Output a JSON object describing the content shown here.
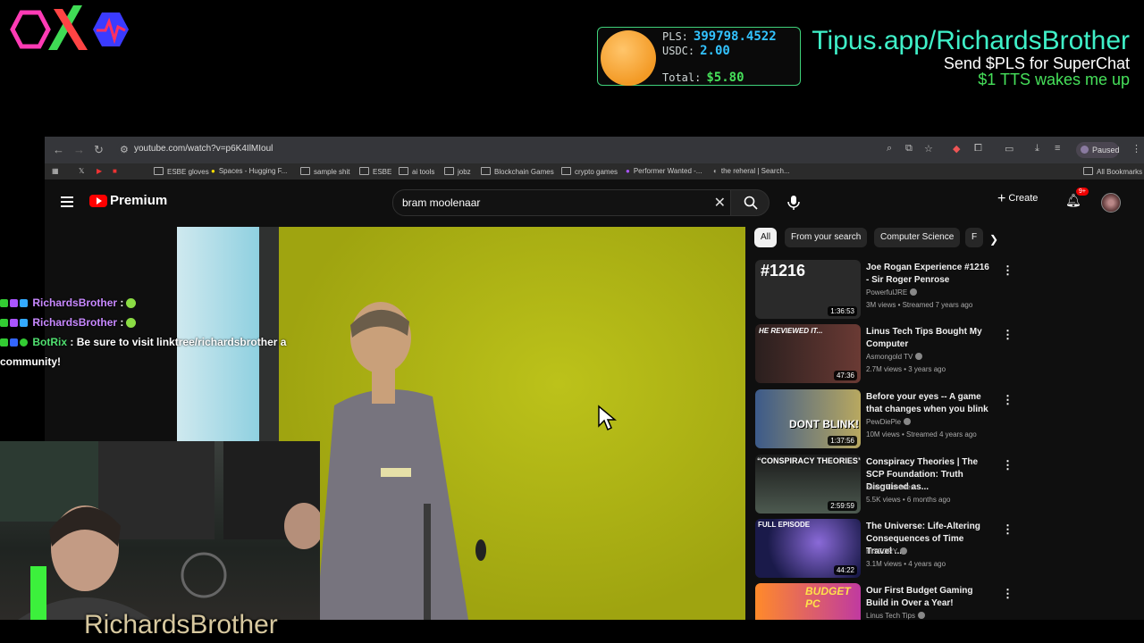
{
  "overlay": {
    "wallet": {
      "pls_label": "PLS:",
      "pls_value": "399798.4522",
      "usdc_label": "USDC:",
      "usdc_value": "2.00",
      "total_label": "Total:",
      "total_value": "$5.80"
    },
    "tip_url": "Tipus.app/RichardsBrother",
    "tip_line1": "Send $PLS for SuperChat",
    "tip_line2": "$1 TTS wakes me up",
    "cam_name": "RichardsBrother"
  },
  "chat": [
    {
      "user": "RichardsBrother",
      "text": ":"
    },
    {
      "user": "RichardsBrother",
      "text": ":"
    },
    {
      "user": "BotRix",
      "text": ": Be sure to visit linktree/richardsbrother a",
      "text2": "community!"
    }
  ],
  "browser": {
    "url": "youtube.com/watch?v=p6K4IlMIoul",
    "paused": "Paused",
    "bookmarks": [
      "ESBE gloves",
      "Spaces - Hugging F...",
      "sample shit",
      "ESBE",
      "ai tools",
      "jobz",
      "Blockchain Games",
      "crypto games",
      "Performer Wanted -...",
      "the reheral | Search..."
    ],
    "all_bookmarks": "All Bookmarks"
  },
  "youtube": {
    "logo": "Premium",
    "search_value": "bram moolenaar",
    "create": "Create",
    "notif_badge": "9+",
    "chips": [
      "All",
      "From your search",
      "Computer Science",
      "F"
    ],
    "recommendations": [
      {
        "title": "Joe Rogan Experience #1216 - Sir Roger Penrose",
        "channel": "PowerfulJRE",
        "meta": "3M views • Streamed 7 years ago",
        "duration": "1:36:53",
        "thumb_text": "#1216",
        "thumb_color": "#2a2a2a"
      },
      {
        "title": "Linus Tech Tips Bought My Computer",
        "channel": "Asmongold TV",
        "meta": "2.7M views • 3 years ago",
        "duration": "47:36",
        "thumb_text": "HE REVIEWED IT...",
        "thumb_color": "#4a2d2a"
      },
      {
        "title": "Before your eyes -- A game that changes when you blink",
        "channel": "PewDiePie",
        "meta": "10M views • Streamed 4 years ago",
        "duration": "1:37:56",
        "thumb_text": "DONT BLINK!",
        "thumb_color": "#3c5a8a"
      },
      {
        "title": "Conspiracy Theories | The SCP Foundation: Truth Disguised as...",
        "channel": "Sleep Theories",
        "meta": "5.5K views • 6 months ago",
        "duration": "2:59:59",
        "thumb_text": "“CONSPIRACY THEORIES”",
        "thumb_color": "#3d4a40"
      },
      {
        "title": "The Universe: Life-Altering Consequences of Time Travel ...",
        "channel": "HISTORY",
        "meta": "3.1M views • 4 years ago",
        "duration": "44:22",
        "thumb_text": "FULL EPISODE",
        "thumb_color": "#2a2a6a"
      },
      {
        "title": "Our First Budget Gaming Build in Over a Year!",
        "channel": "Linus Tech Tips",
        "meta": "",
        "duration": "",
        "thumb_text": "BUDGET PC",
        "thumb_color": "#c03aa0"
      }
    ]
  }
}
